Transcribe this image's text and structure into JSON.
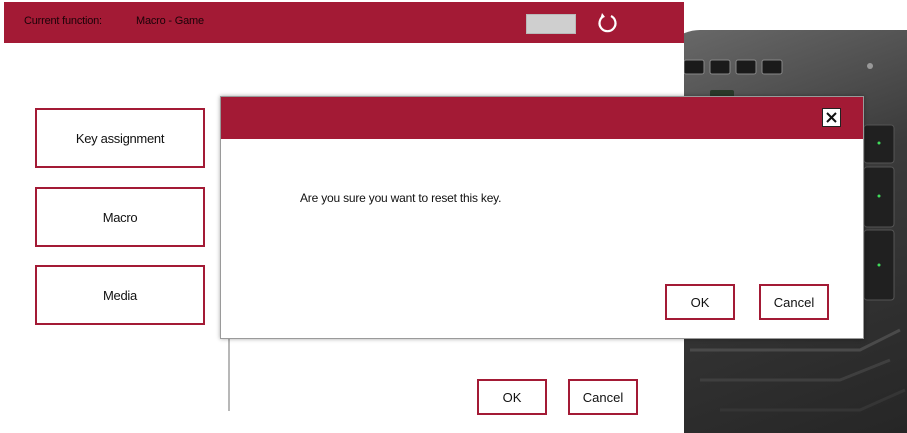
{
  "app": {
    "title_label": "Current function:",
    "title_value": "Macro - Game"
  },
  "sidebar": {
    "items": [
      {
        "label": "Key assignment"
      },
      {
        "label": "Macro"
      },
      {
        "label": "Media"
      }
    ]
  },
  "footer": {
    "ok_label": "OK",
    "cancel_label": "Cancel"
  },
  "dialog": {
    "message": "Are you sure you want to reset this key.",
    "ok_label": "OK",
    "cancel_label": "Cancel"
  },
  "colors": {
    "accent": "#a31a35",
    "swatch": "#cfcfcf"
  }
}
